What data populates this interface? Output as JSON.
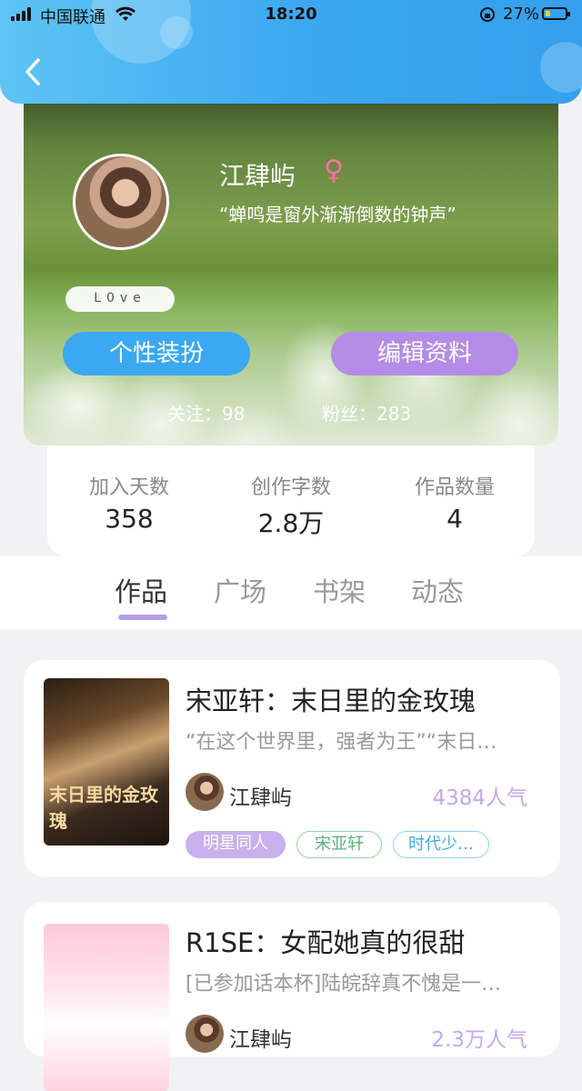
{
  "status_bar": {
    "carrier": "中国联通",
    "time": "18:20",
    "battery": "27%",
    "battery_level": 0.27
  },
  "profile": {
    "name": "江肆屿",
    "gender_symbol": "♀",
    "motto": "“蝉鸣是窗外渐渐倒数的钟声”",
    "badge": "L0ve",
    "dress_button": "个性装扮",
    "edit_button": "编辑资料",
    "following": "关注：98",
    "followers": "粉丝：283"
  },
  "stats": [
    {
      "label": "加入天数",
      "value": "358"
    },
    {
      "label": "创作字数",
      "value": "2.8万"
    },
    {
      "label": "作品数量",
      "value": "4"
    }
  ],
  "tabs": [
    "作品",
    "广场",
    "书架",
    "动态"
  ],
  "works": [
    {
      "cover_text": "末日里的金玫瑰",
      "title": "宋亚轩：末日里的金玫瑰",
      "desc": "“在这个世界里，强者为王”“末日…",
      "author": "江肆屿",
      "popularity": "4384人气",
      "tags": [
        "明星同人",
        "宋亚轩",
        "时代少…"
      ]
    },
    {
      "title": "R1SE：女配她真的很甜",
      "desc": "[已参加话本杯]陆皖辞真不愧是一…",
      "author": "江肆屿",
      "popularity": "2.3万人气"
    }
  ],
  "colors": {
    "accent_blue": "#3aa8f2",
    "accent_purple": "#b48ce6",
    "topbar": "#3aa7f0"
  }
}
